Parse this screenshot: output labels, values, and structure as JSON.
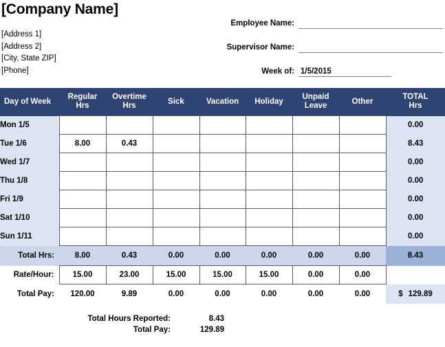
{
  "company": {
    "name": "[Company Name]",
    "address_lines": [
      "[Address 1]",
      "[Address 2]",
      "[City, State  ZIP]",
      "[Phone]"
    ]
  },
  "form": {
    "employee_label": "Employee Name:",
    "employee_value": "",
    "supervisor_label": "Supervisor Name:",
    "supervisor_value": "",
    "week_label": "Week of:",
    "week_value": "1/5/2015"
  },
  "table": {
    "columns": [
      "Day of Week",
      "Regular\nHrs",
      "Overtime\nHrs",
      "Sick",
      "Vacation",
      "Holiday",
      "Unpaid\nLeave",
      "Other",
      "TOTAL\nHrs"
    ],
    "column_headers": {
      "day": "Day of Week",
      "regular_l1": "Regular",
      "regular_l2": "Hrs",
      "overtime_l1": "Overtime",
      "overtime_l2": "Hrs",
      "sick": "Sick",
      "vacation": "Vacation",
      "holiday": "Holiday",
      "unpaid_l1": "Unpaid",
      "unpaid_l2": "Leave",
      "other": "Other",
      "total_l1": "TOTAL",
      "total_l2": "Hrs"
    },
    "rows": [
      {
        "day": "Mon 1/5",
        "regular": "",
        "overtime": "",
        "sick": "",
        "vacation": "",
        "holiday": "",
        "unpaid": "",
        "other": "",
        "total": "0.00"
      },
      {
        "day": "Tue 1/6",
        "regular": "8.00",
        "overtime": "0.43",
        "sick": "",
        "vacation": "",
        "holiday": "",
        "unpaid": "",
        "other": "",
        "total": "8.43"
      },
      {
        "day": "Wed 1/7",
        "regular": "",
        "overtime": "",
        "sick": "",
        "vacation": "",
        "holiday": "",
        "unpaid": "",
        "other": "",
        "total": "0.00"
      },
      {
        "day": "Thu 1/8",
        "regular": "",
        "overtime": "",
        "sick": "",
        "vacation": "",
        "holiday": "",
        "unpaid": "",
        "other": "",
        "total": "0.00"
      },
      {
        "day": "Fri 1/9",
        "regular": "",
        "overtime": "",
        "sick": "",
        "vacation": "",
        "holiday": "",
        "unpaid": "",
        "other": "",
        "total": "0.00"
      },
      {
        "day": "Sat 1/10",
        "regular": "",
        "overtime": "",
        "sick": "",
        "vacation": "",
        "holiday": "",
        "unpaid": "",
        "other": "",
        "total": "0.00"
      },
      {
        "day": "Sun 1/11",
        "regular": "",
        "overtime": "",
        "sick": "",
        "vacation": "",
        "holiday": "",
        "unpaid": "",
        "other": "",
        "total": "0.00"
      }
    ],
    "total_hours": {
      "label": "Total Hrs:",
      "regular": "8.00",
      "overtime": "0.43",
      "sick": "0.00",
      "vacation": "0.00",
      "holiday": "0.00",
      "unpaid": "0.00",
      "other": "0.00",
      "total": "8.43"
    },
    "rate_per_hour": {
      "label": "Rate/Hour:",
      "regular": "15.00",
      "overtime": "23.00",
      "sick": "15.00",
      "vacation": "15.00",
      "holiday": "15.00",
      "unpaid": "0.00",
      "other": "0.00",
      "total": ""
    },
    "total_pay": {
      "label": "Total Pay:",
      "regular": "120.00",
      "overtime": "9.89",
      "sick": "0.00",
      "vacation": "0.00",
      "holiday": "0.00",
      "unpaid": "0.00",
      "other": "0.00",
      "currency": "$",
      "total": "129.89"
    }
  },
  "summary": {
    "hours_label": "Total Hours Reported:",
    "hours_value": "8.43",
    "pay_label": "Total Pay:",
    "pay_value": "129.89"
  },
  "colors": {
    "header_navy": "#2e4372",
    "tint_light": "#dce3f2",
    "tint_medium": "#ccd6ea",
    "tint_strong": "#9db2d8",
    "grid_line": "#555b66",
    "rule_line": "#808080"
  }
}
